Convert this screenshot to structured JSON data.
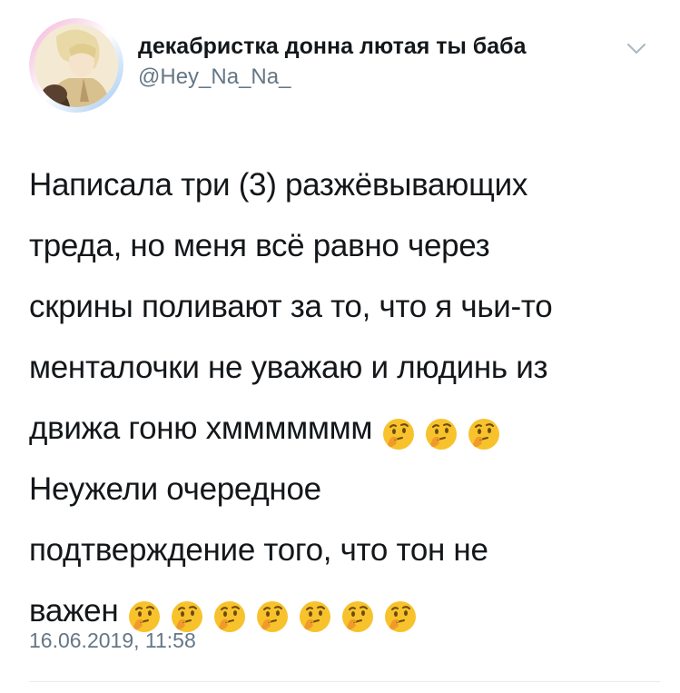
{
  "author": {
    "display_name": "декабристка донна лютая ты баба",
    "handle": "@Hey_Na_Na_"
  },
  "tweet": {
    "lines": [
      "Написала три (3) разжёвывающих",
      "треда, но меня всё равно через",
      "скрины поливают за то, что я чьи-то",
      "менталочки не уважаю и людинь из",
      "движа гоню хммммммм",
      "Неужели очередное",
      "подтверждение того, что тон не",
      "важен"
    ],
    "emoji_after_line_5": 3,
    "emoji_after_line_8": 7,
    "emoji_name": "thinking-face-emoji"
  },
  "timestamp": "16.06.2019, 11:58",
  "colors": {
    "text": "#14171a",
    "secondary": "#657786",
    "divider": "#e6ecf0",
    "emoji_face": "#f7c22b"
  }
}
